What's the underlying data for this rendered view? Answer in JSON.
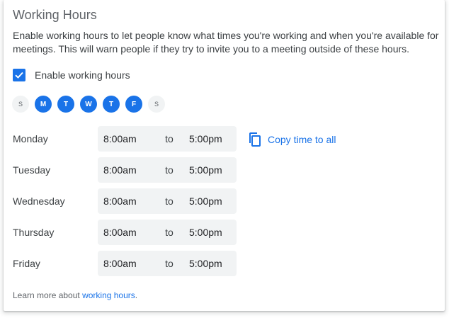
{
  "title": "Working Hours",
  "description": "Enable working hours to let people know what times you're working and when you're available for meetings. This will warn people if they try to invite you to a meeting outside of these hours.",
  "enable": {
    "label": "Enable working hours",
    "checked": true
  },
  "days": [
    {
      "letter": "S",
      "selected": false
    },
    {
      "letter": "M",
      "selected": true
    },
    {
      "letter": "T",
      "selected": true
    },
    {
      "letter": "W",
      "selected": true
    },
    {
      "letter": "T",
      "selected": true
    },
    {
      "letter": "F",
      "selected": true
    },
    {
      "letter": "S",
      "selected": false
    }
  ],
  "schedule": [
    {
      "day": "Monday",
      "start": "8:00am",
      "to": "to",
      "end": "5:00pm"
    },
    {
      "day": "Tuesday",
      "start": "8:00am",
      "to": "to",
      "end": "5:00pm"
    },
    {
      "day": "Wednesday",
      "start": "8:00am",
      "to": "to",
      "end": "5:00pm"
    },
    {
      "day": "Thursday",
      "start": "8:00am",
      "to": "to",
      "end": "5:00pm"
    },
    {
      "day": "Friday",
      "start": "8:00am",
      "to": "to",
      "end": "5:00pm"
    }
  ],
  "copy_label": "Copy time to all",
  "copy_icon": "copy-icon",
  "footer": {
    "prefix": "Learn more about ",
    "link": "working hours",
    "suffix": "."
  },
  "colors": {
    "accent": "#1a73e8",
    "field_bg": "#f1f3f4",
    "text": "#3c4043"
  }
}
